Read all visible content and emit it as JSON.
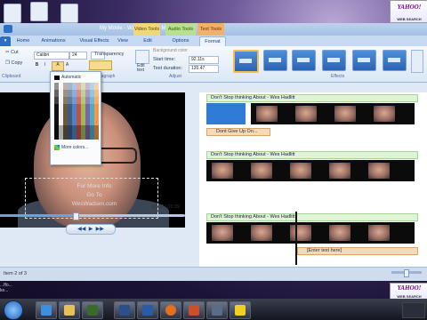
{
  "desktop": {
    "overlay_line1": "...ffo...",
    "overlay_line2": "ke...",
    "yahoo_logo": "YAHOO!",
    "yahoo_sub": "WEB SEARCH"
  },
  "window": {
    "title": "My Movie - Windows Live Movie Maker"
  },
  "context_tabs": [
    "Video Tools",
    "Audio Tools",
    "Text Tools"
  ],
  "tabs": [
    "Home",
    "Animations",
    "Visual Effects",
    "View",
    "Edit",
    "Options",
    "Format"
  ],
  "ribbon": {
    "cut": "Cut",
    "copy": "Copy",
    "clipboard_group": "Clipboard",
    "font_name": "Calibri",
    "font_size": "24",
    "transparency": "Transparency",
    "paragraph_group": "Paragraph",
    "edit_text": "Edit text",
    "background_color": "Background color",
    "start_time_label": "Start time:",
    "start_time_value": "92.11s",
    "text_duration_label": "Text duration:",
    "text_duration_value": "120.47",
    "adjust_group": "Adjust",
    "effects_group": "Effects"
  },
  "color_popup": {
    "automatic": "Automatic",
    "more_colors": "More colors..."
  },
  "preview": {
    "overlay_text_1": "For More Info",
    "overlay_text_2": "Go To",
    "overlay_text_3": "WesWadsen.com",
    "time": "01:32 / 03:39"
  },
  "storyboard": {
    "rows": [
      {
        "audio": "Don't Stop thinking About - Wes Hadlitt",
        "caption": "Dont Give Up On..."
      },
      {
        "audio": "Don't Stop thinking About - Wes Hadlitt",
        "caption": ""
      },
      {
        "audio": "Don't Stop thinking About - Wes Hadlitt",
        "caption": "[Enter text here]"
      }
    ]
  },
  "status": {
    "item": "Item 2 of 3"
  },
  "taskbar": {
    "items": [
      "ie",
      "explorer",
      "media",
      "photoshop",
      "word",
      "firefox",
      "powerpoint",
      "movie-maker",
      "aim"
    ]
  }
}
